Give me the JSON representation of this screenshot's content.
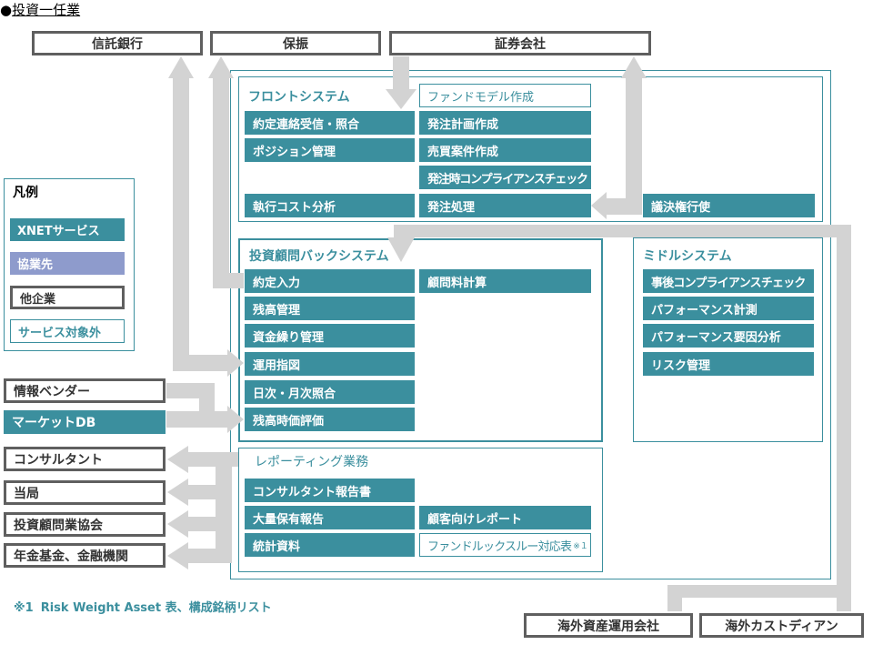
{
  "header": {
    "bullet": "●",
    "title": "投資一任業"
  },
  "colors": {
    "xnet_service": "#3b8f9e",
    "partner": "#8e9bcc",
    "other_company_border": "#5f5f5f",
    "arrow": "#d3d3d3",
    "text_dark": "#333333"
  },
  "external_top": [
    "信託銀行",
    "保振",
    "証券会社"
  ],
  "front_system": {
    "title": "フロントシステム",
    "column_left": [
      "約定連絡受信・照合",
      "ポジション管理",
      "執行コスト分析"
    ],
    "column_center": [
      "ファンドモデル作成",
      "発注計画作成",
      "売買案件作成",
      "発注時コンプライアンスチェック",
      "発注処理"
    ],
    "column_right": [
      "議決権行使"
    ]
  },
  "back_system": {
    "title": "投資顧問バックシステム",
    "column_left": [
      "約定入力",
      "残高管理",
      "資金繰り管理",
      "運用指図",
      "日次・月次照合",
      "残高時価評価"
    ],
    "column_right": [
      "顧問料計算"
    ]
  },
  "middle_system": {
    "title": "ミドルシステム",
    "items": [
      "事後コンプライアンスチェック",
      "パフォーマンス計測",
      "パフォーマンス要因分析",
      "リスク管理"
    ]
  },
  "reporting": {
    "title": "レポーティング業務",
    "column_left": [
      "コンサルタント報告書",
      "大量保有報告",
      "統計資料"
    ],
    "column_right": [
      {
        "label": "顧客向けレポート"
      },
      {
        "label": "ファンドルックスルー対応表",
        "note_mark": "※１"
      }
    ]
  },
  "legend": {
    "title": "凡例",
    "items": [
      "XNETサービス",
      "協業先",
      "他企業",
      "サービス対象外"
    ]
  },
  "external_left": {
    "inputs": [
      "情報ベンダー",
      "マーケットDB"
    ],
    "outputs": [
      "コンサルタント",
      "当局",
      "投資顧問業協会",
      "年金基金、金融機関"
    ]
  },
  "external_bottom": [
    "海外資産運用会社",
    "海外カストディアン"
  ],
  "footnote": {
    "mark": "※1",
    "text": "Risk Weight Asset 表、構成銘柄リスト"
  }
}
